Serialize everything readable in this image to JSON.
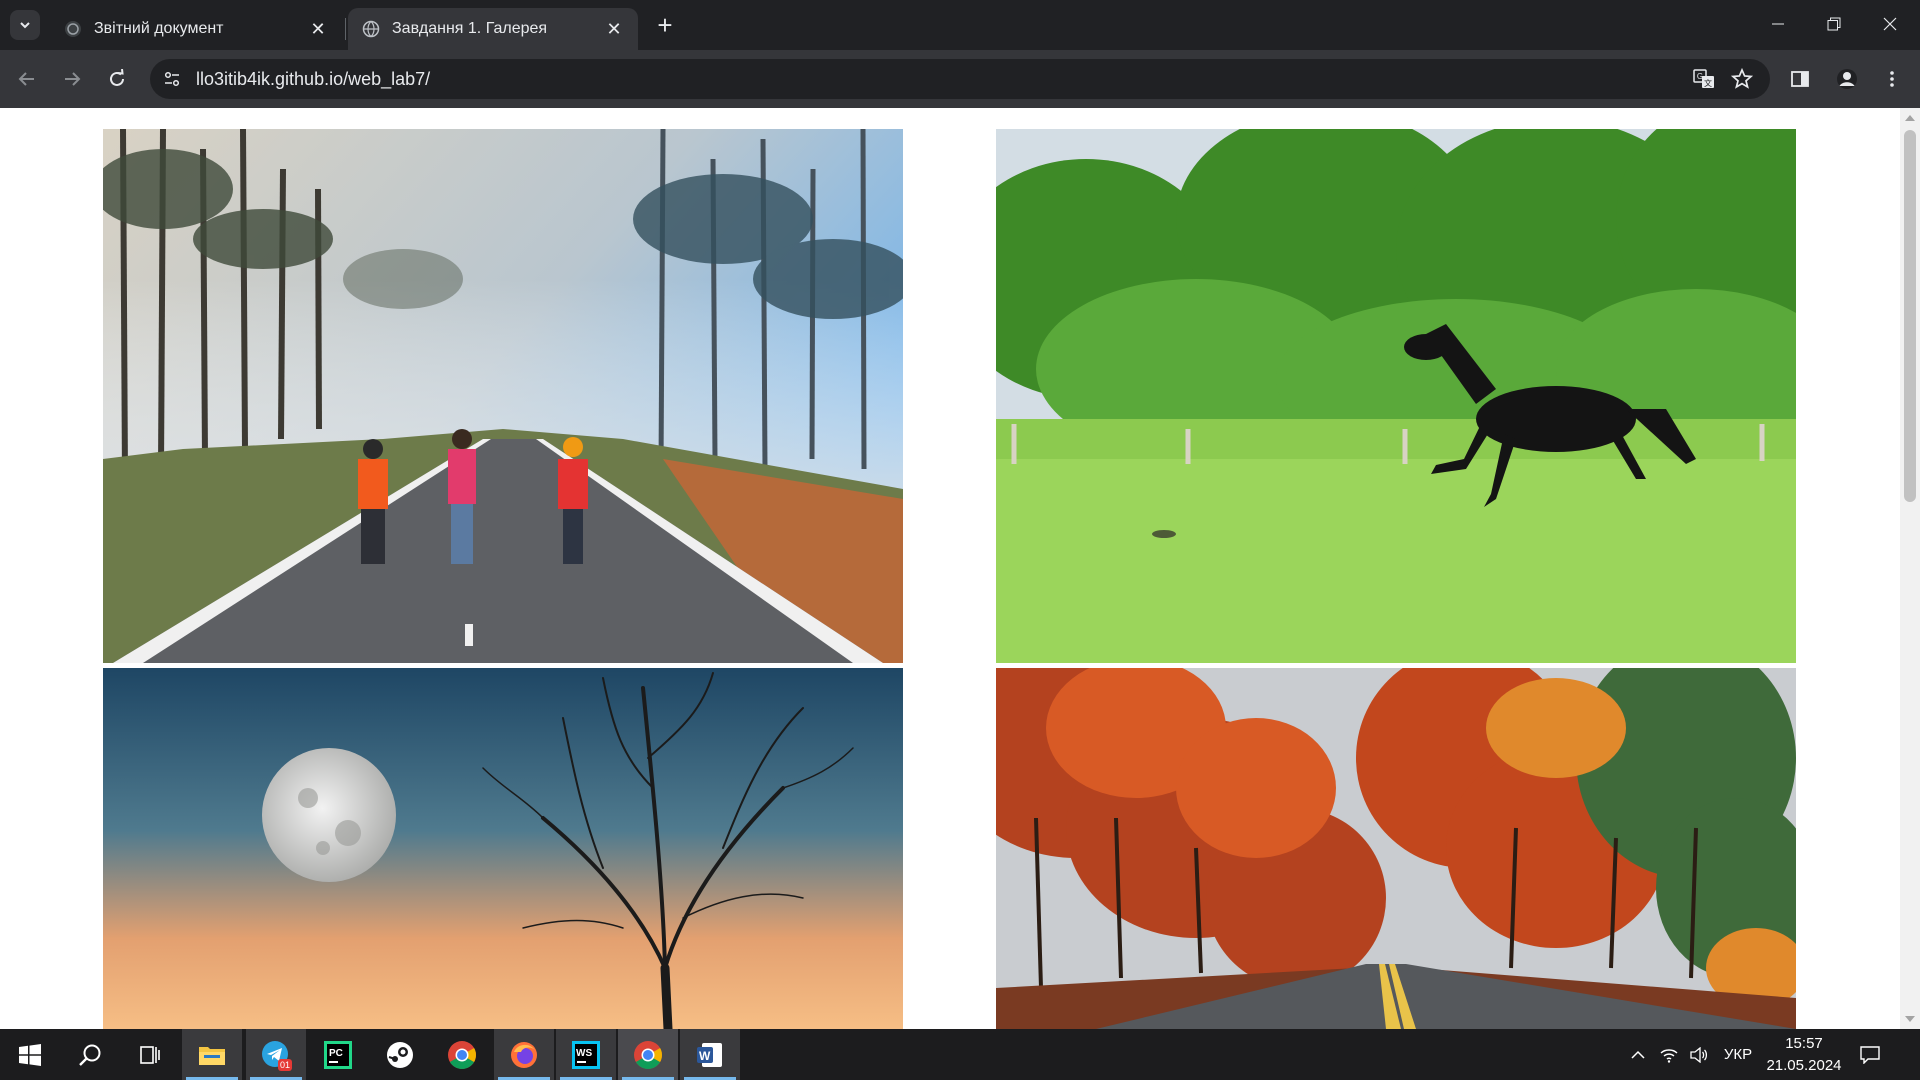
{
  "browser": {
    "tabs": [
      {
        "title": "Звітний документ",
        "active": false,
        "icon": "document-favicon-icon"
      },
      {
        "title": "Завдання 1. Галерея",
        "active": true,
        "icon": "globe-favicon-icon"
      }
    ],
    "url": "llo3itib4ik.github.io/web_lab7/"
  },
  "gallery": {
    "images": [
      {
        "subject": "road-in-misty-pine-forest-with-three-people"
      },
      {
        "subject": "black-horse-galloping-on-green-meadow"
      },
      {
        "subject": "full-moon-and-bare-tree-at-dusk"
      },
      {
        "subject": "autumn-road-with-red-trees"
      }
    ]
  },
  "taskbar": {
    "apps": [
      "start-icon",
      "search-icon",
      "task-view-icon",
      "file-explorer-icon",
      "telegram-icon",
      "pycharm-icon",
      "steam-icon",
      "chrome-icon",
      "firefox-icon",
      "webstorm-icon",
      "chrome-icon",
      "word-icon"
    ],
    "telegram_badge": "01",
    "language": "УКР",
    "time": "15:57",
    "date": "21.05.2024"
  },
  "colors": {
    "accent": "#76b9ed",
    "chrome_dark": "#202124",
    "chrome_tab": "#35363a"
  }
}
